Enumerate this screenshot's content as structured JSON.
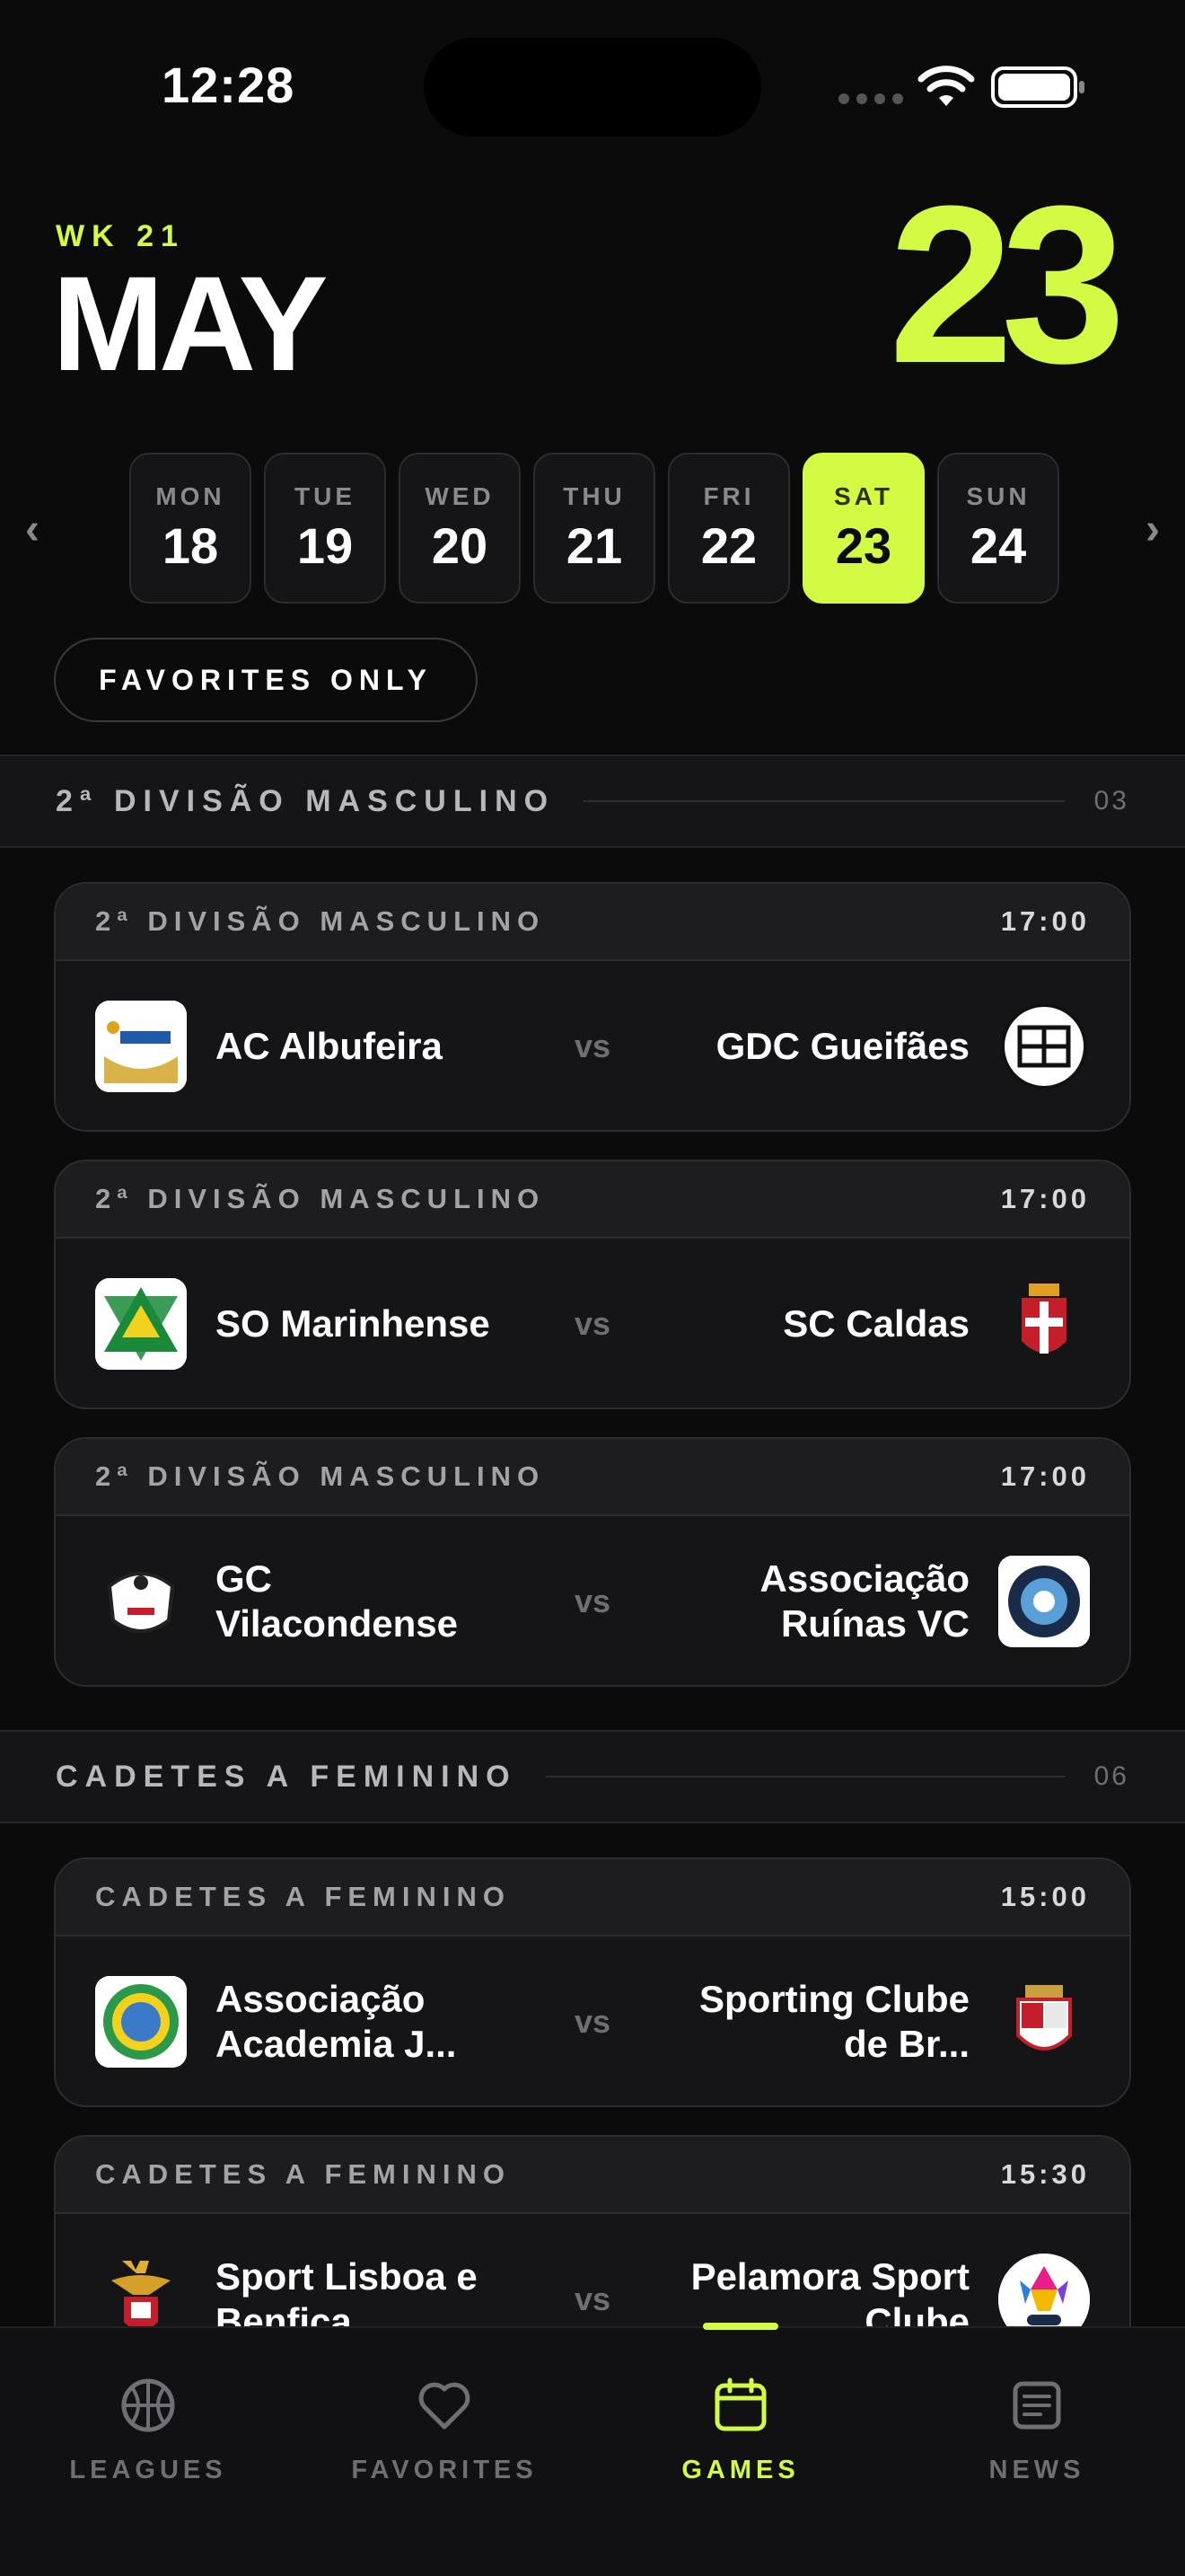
{
  "status": {
    "time": "12:28"
  },
  "header": {
    "week": "WK 21",
    "month": "MAY",
    "day": "23"
  },
  "days": [
    {
      "name": "MON",
      "num": "18"
    },
    {
      "name": "TUE",
      "num": "19"
    },
    {
      "name": "WED",
      "num": "20"
    },
    {
      "name": "THU",
      "num": "21"
    },
    {
      "name": "FRI",
      "num": "22"
    },
    {
      "name": "SAT",
      "num": "23",
      "selected": true
    },
    {
      "name": "SUN",
      "num": "24"
    }
  ],
  "nav": {
    "prev": "‹",
    "next": "›"
  },
  "filter": {
    "label": "FAVORITES ONLY"
  },
  "sections": [
    {
      "title": "2ª DIVISÃO MASCULINO",
      "count": "03",
      "matches": [
        {
          "league": "2ª DIVISÃO MASCULINO",
          "time": "17:00",
          "home": "AC Albufeira",
          "away": "GDC Gueifães",
          "vs": "vs"
        },
        {
          "league": "2ª DIVISÃO MASCULINO",
          "time": "17:00",
          "home": "SO Marinhense",
          "away": "SC Caldas",
          "vs": "vs"
        },
        {
          "league": "2ª DIVISÃO MASCULINO",
          "time": "17:00",
          "home": "GC Vilacondense",
          "away": "Associação Ruínas VC",
          "vs": "vs"
        }
      ]
    },
    {
      "title": "CADETES A FEMININO",
      "count": "06",
      "matches": [
        {
          "league": "CADETES A FEMININO",
          "time": "15:00",
          "home": "Associação Academia J...",
          "away": "Sporting Clube de Br...",
          "vs": "vs"
        },
        {
          "league": "CADETES A FEMININO",
          "time": "15:30",
          "home": "Sport Lisboa e Benfica",
          "away": "Pelamora Sport Clube",
          "vs": "vs"
        }
      ]
    }
  ],
  "tabs": [
    {
      "label": "LEAGUES",
      "icon": "basketball-icon"
    },
    {
      "label": "FAVORITES",
      "icon": "heart-icon"
    },
    {
      "label": "GAMES",
      "icon": "calendar-icon",
      "active": true
    },
    {
      "label": "NEWS",
      "icon": "news-icon"
    }
  ],
  "colors": {
    "accent": "#d4fb43",
    "background": "#0b0b0c",
    "card": "#151517"
  }
}
